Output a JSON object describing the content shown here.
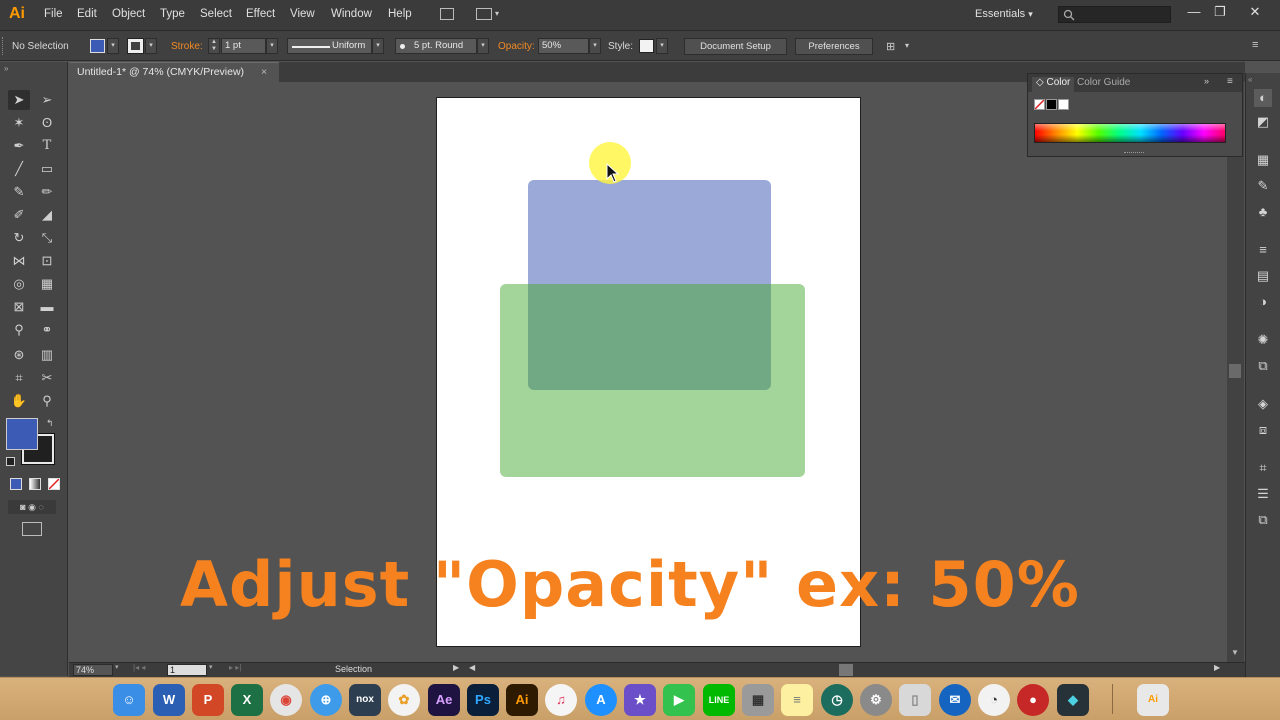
{
  "app": {
    "logo": "Ai"
  },
  "menu": [
    "File",
    "Edit",
    "Object",
    "Type",
    "Select",
    "Effect",
    "View",
    "Window",
    "Help"
  ],
  "workspace": {
    "label": "Essentials",
    "dropdown": "▾"
  },
  "window_controls": {
    "minimize": "—",
    "restore": "❐",
    "close": "✕"
  },
  "control_bar": {
    "selection_status": "No Selection",
    "stroke_label": "Stroke:",
    "stroke_value": "1 pt",
    "profile_value": "Uniform",
    "brush_value": "5 pt. Round",
    "opacity_label": "Opacity:",
    "opacity_value": "50%",
    "style_label": "Style:",
    "document_setup": "Document Setup",
    "preferences": "Preferences"
  },
  "document": {
    "tab_title": "Untitled-1* @ 74% (CMYK/Preview)",
    "close": "×"
  },
  "status_bar": {
    "zoom": "74%",
    "artboard_number": "1",
    "tool": "Selection"
  },
  "color_panel": {
    "tab_color": "Color",
    "tab_guide": "Color Guide"
  },
  "caption": "Adjust \"Opacity\" ex: 50%",
  "colors": {
    "fill_swatch": "#3b5bb5",
    "blue_rect": "#3654b0",
    "green_rect": "#48aa34",
    "caption": "#f5821f",
    "accent": "#ff9a00"
  },
  "artwork": [
    {
      "name": "blue-rounded-rectangle",
      "fill": "#3654b0",
      "opacity": 0.5
    },
    {
      "name": "green-rounded-rectangle",
      "fill": "#48aa34",
      "opacity": 0.5
    }
  ],
  "taskbar_apps": [
    "Finder",
    "Word",
    "PowerPoint",
    "Excel",
    "Chrome",
    "Safari",
    "Nox",
    "Photos",
    "After Effects",
    "Photoshop",
    "Illustrator",
    "Music",
    "App Store",
    "iMovie",
    "FaceTime",
    "LINE",
    "Calculator",
    "Notes",
    "Time Machine",
    "System Preferences",
    "Trash",
    "Mail",
    "Clock",
    "Photo Booth",
    "Filmora",
    "Illustrator Window"
  ]
}
